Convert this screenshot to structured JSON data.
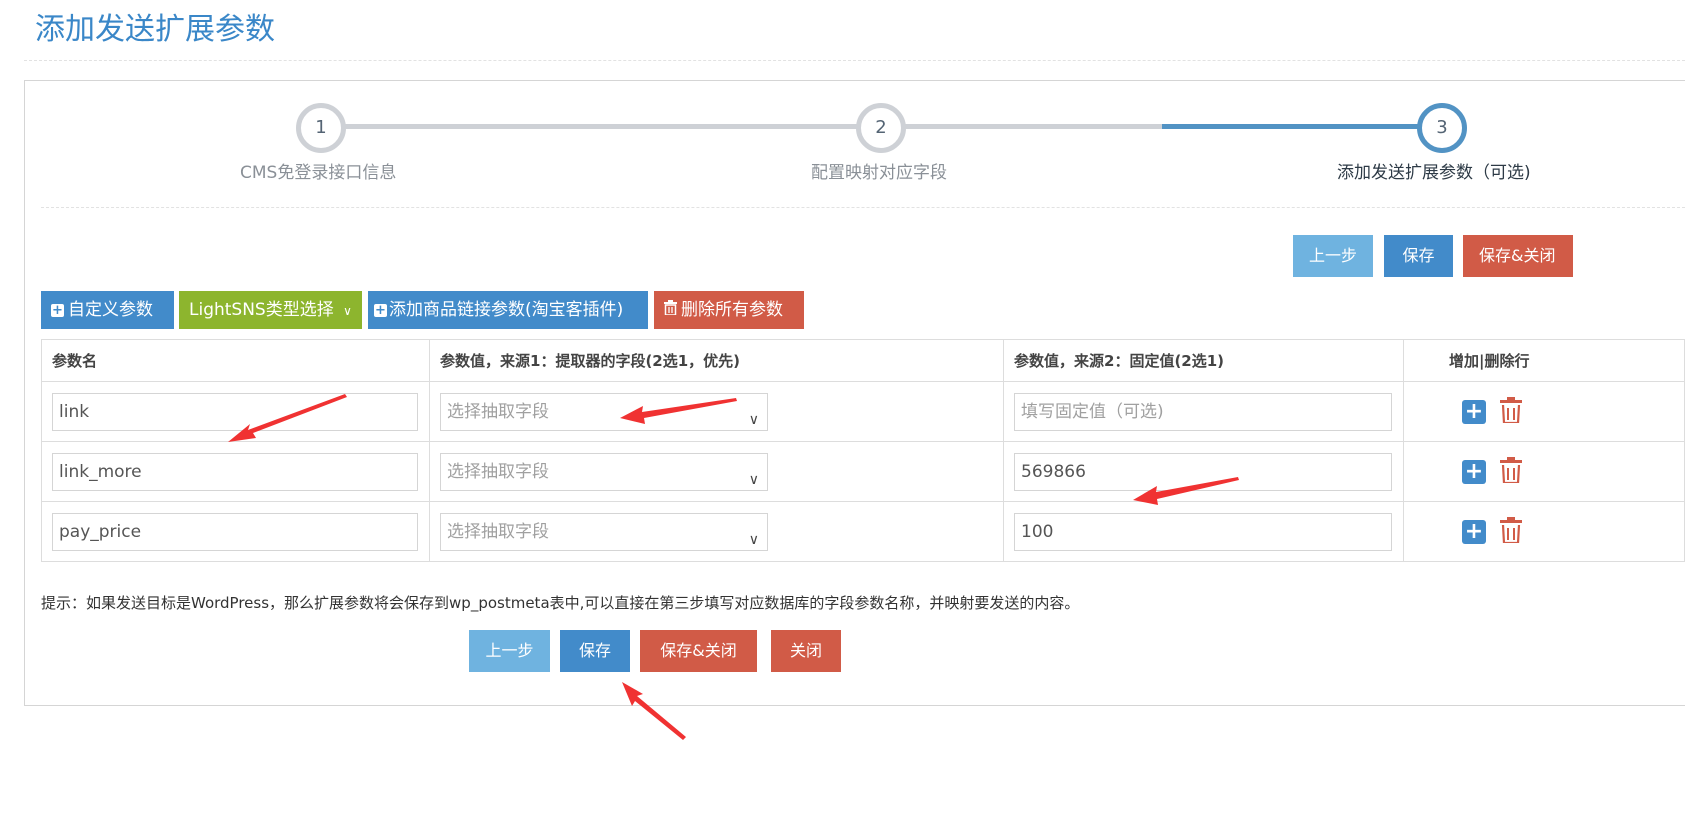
{
  "page": {
    "title": "添加发送扩展参数"
  },
  "steps": [
    {
      "number": "1",
      "label": "CMS免登录接口信息",
      "active": false
    },
    {
      "number": "2",
      "label": "配置映射对应字段",
      "active": false
    },
    {
      "number": "3",
      "label": "添加发送扩展参数（可选)",
      "active": true
    }
  ],
  "top_actions": {
    "prev": "上一步",
    "save": "保存",
    "save_close": "保存&关闭"
  },
  "toolbar": {
    "custom_param": "自定义参数",
    "lightsns_select": "LightSNS类型选择",
    "add_goods_link": "添加商品链接参数(淘宝客插件)",
    "delete_all": "删除所有参数"
  },
  "table": {
    "headers": [
      "参数名",
      "参数值，来源1：提取器的字段(2选1，优先)",
      "参数值，来源2：固定值(2选1)",
      "增加|删除行"
    ],
    "rows": [
      {
        "name": "link",
        "field_select": "选择抽取字段",
        "fixed_value": "",
        "fixed_placeholder": "填写固定值（可选)"
      },
      {
        "name": "link_more",
        "field_select": "选择抽取字段",
        "fixed_value": "569866",
        "fixed_placeholder": ""
      },
      {
        "name": "pay_price",
        "field_select": "选择抽取字段",
        "fixed_value": "100",
        "fixed_placeholder": ""
      }
    ]
  },
  "tip": "提示：如果发送目标是WordPress，那么扩展参数将会保存到wp_postmeta表中,可以直接在第三步填写对应数据库的字段参数名称，并映射要发送的内容。",
  "bottom_actions": {
    "prev": "上一步",
    "save": "保存",
    "save_close": "保存&关闭",
    "close": "关闭"
  },
  "colors": {
    "primary": "#428bca",
    "info": "#6fb3e0",
    "danger": "#d15b47",
    "lime": "#8db52e",
    "annotation_arrow": "#f03232"
  }
}
